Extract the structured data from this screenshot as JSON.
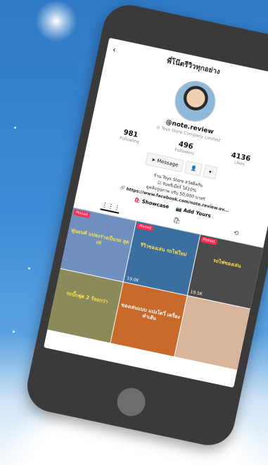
{
  "profile": {
    "title": "พี่โน๊ตรีวิวทุกอย่าง",
    "handle": "@note.review",
    "store": "◎ Toys Store Company Limited",
    "stats": [
      {
        "value": "981",
        "label": "Following"
      },
      {
        "value": "496",
        "label": "Followers"
      },
      {
        "value": "4136",
        "label": "Likes"
      }
    ],
    "message_label": "Message",
    "bio_line1": "ร้าน Toys Store สวัสดีครับ",
    "bio_line2": "☑ รับพรีเมียร์ ได้10%",
    "bio_line3": "ดูคลิปรูปภาพ ปรับ 50,000 บาท‼",
    "link": "https://www.facebook.com/note.review.ev...",
    "showcase_label": "Showcase",
    "add_yours_label": "Add Yours"
  },
  "videos": [
    {
      "pinned": "Pinned",
      "caption": "หุ่นยนต์ แปลงร่างเป็นรถ สุดเท่",
      "views": "",
      "bg": "#6f8fbf"
    },
    {
      "pinned": "Pinned",
      "caption": "รีวิวของเล่น รถไฟใหม่",
      "views": "19.0K",
      "bg": "#3b6fa0"
    },
    {
      "pinned": "Pinned",
      "caption": "รถไฟของเล่น",
      "views": "19.5K",
      "bg": "#4b4b4b"
    },
    {
      "pinned": "",
      "caption": "รถบั๊กฟุต 2 ร้อยกว่า",
      "views": "",
      "bg": "#8a8a5a"
    },
    {
      "pinned": "",
      "caption": "ของเล่นแบบ แปงโตวี่ เครื่องทำเส้น",
      "views": "",
      "bg": "#c9692a"
    },
    {
      "pinned": "",
      "caption": "",
      "views": "",
      "bg": "#d7b49a"
    }
  ],
  "colors": {
    "pinned": "#fe2c55",
    "accent": "#e1306c"
  }
}
